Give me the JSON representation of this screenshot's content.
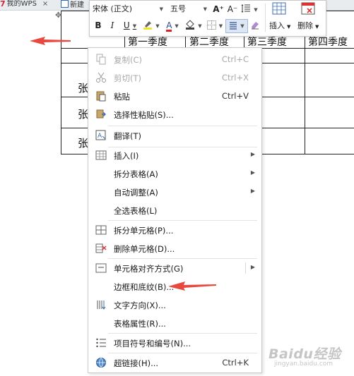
{
  "tabs": [
    {
      "label": "我的WPS",
      "close": "×"
    },
    {
      "label": "新建"
    }
  ],
  "table": {
    "headers": [
      "第一季度",
      "第二季度",
      "第三季度",
      "第四季度"
    ],
    "row_labels": [
      "张",
      "张",
      "张"
    ]
  },
  "toolbar": {
    "font_name": "宋体 (正文)",
    "font_size": "五号",
    "grow_font": "A⁺",
    "shrink_font": "A⁻",
    "bold": "B",
    "italic": "I",
    "underline": "U",
    "font_color_label": "A",
    "insert_label": "插入",
    "delete_label": "删除"
  },
  "menu": {
    "copy": {
      "label": "复制(C)",
      "shortcut": "Ctrl+C"
    },
    "cut": {
      "label": "剪切(T)",
      "shortcut": "Ctrl+X"
    },
    "paste": {
      "label": "粘贴",
      "shortcut": "Ctrl+V"
    },
    "paste_special": {
      "label": "选择性粘贴(S)..."
    },
    "translate": {
      "label": "翻译(T)"
    },
    "insert": {
      "label": "插入(I)"
    },
    "split_table": {
      "label": "拆分表格(A)"
    },
    "autofit": {
      "label": "自动调整(A)"
    },
    "select_table": {
      "label": "全选表格(L)"
    },
    "split_cells": {
      "label": "拆分单元格(P)..."
    },
    "delete_cells": {
      "label": "删除单元格(D)..."
    },
    "cell_alignment": {
      "label": "单元格对齐方式(G)"
    },
    "borders_shading": {
      "label": "边框和底纹(B)..."
    },
    "text_direction": {
      "label": "文字方向(X)..."
    },
    "table_properties": {
      "label": "表格属性(R)..."
    },
    "bullets_numbering": {
      "label": "项目符号和编号(N)..."
    },
    "hyperlink": {
      "label": "超链接(H)...",
      "shortcut": "Ctrl+K"
    }
  },
  "watermark": {
    "brand": "Baidu经验",
    "sub": "jingyan.baidu.com"
  },
  "colors": {
    "annotation_red": "#e8483e",
    "font_color_red": "#e02020",
    "highlight_yellow": "#f5e330",
    "menu_border": "#c9c9c9",
    "icon_blue": "#3b6cb5"
  }
}
